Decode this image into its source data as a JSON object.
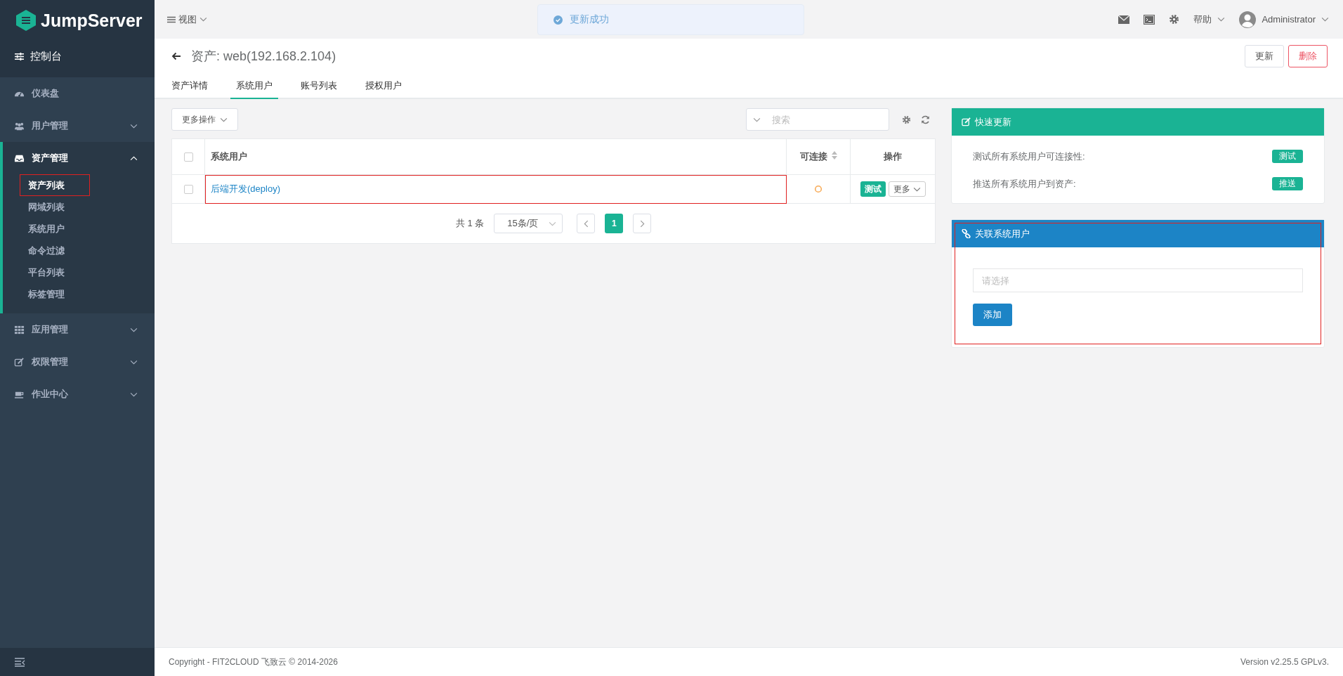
{
  "sidebar": {
    "logo": "JumpServer",
    "console": "控制台",
    "items": [
      {
        "label": "仪表盘",
        "kind": "link"
      },
      {
        "label": "用户管理",
        "kind": "group",
        "expanded": false
      },
      {
        "label": "资产管理",
        "kind": "group",
        "expanded": true,
        "children": [
          {
            "label": "资产列表",
            "selected": true,
            "highlighted": true
          },
          {
            "label": "网域列表",
            "selected": false,
            "highlighted": false
          },
          {
            "label": "系统用户",
            "selected": false,
            "highlighted": false
          },
          {
            "label": "命令过滤",
            "selected": false,
            "highlighted": false
          },
          {
            "label": "平台列表",
            "selected": false,
            "highlighted": false
          },
          {
            "label": "标签管理",
            "selected": false,
            "highlighted": false
          }
        ]
      },
      {
        "label": "应用管理",
        "kind": "group",
        "expanded": false
      },
      {
        "label": "权限管理",
        "kind": "group",
        "expanded": false
      },
      {
        "label": "作业中心",
        "kind": "group",
        "expanded": false
      }
    ]
  },
  "topbar": {
    "view_menu": "视图",
    "toast": "更新成功",
    "help": "帮助",
    "user": "Administrator"
  },
  "header": {
    "title": "资产: web(192.168.2.104)",
    "buttons": [
      {
        "label": "更新",
        "kind": "default"
      },
      {
        "label": "删除",
        "kind": "danger"
      }
    ],
    "tabs": [
      {
        "label": "资产详情",
        "selected": false
      },
      {
        "label": "系统用户",
        "selected": true
      },
      {
        "label": "账号列表",
        "selected": false
      },
      {
        "label": "授权用户",
        "selected": false
      }
    ]
  },
  "table": {
    "more_actions": "更多操作",
    "search": {
      "placeholder": "搜索"
    },
    "header_checked": false,
    "columns": [
      "系统用户",
      "可连接",
      "操作"
    ],
    "rows": [
      {
        "name": "后端开发(deploy)",
        "checked": false,
        "highlighted": true,
        "connectivity": {
          "color": "#f8ac59"
        },
        "test": "测试",
        "more": "更多"
      }
    ],
    "pagination": {
      "total": "共 1 条",
      "page_size": "15条/页",
      "pages": [
        {
          "label": "1",
          "selected": true
        }
      ]
    }
  },
  "panels": {
    "quick_update": {
      "title": "快速更新",
      "actions": [
        {
          "label": "测试所有系统用户可连接性:",
          "button": "测试"
        },
        {
          "label": "推送所有系统用户到资产:",
          "button": "推送"
        }
      ]
    },
    "relate": {
      "title": "关联系统用户",
      "placeholder": "请选择",
      "button": "添加",
      "highlighted": true
    }
  },
  "footer": {
    "copyright": "Copyright - FIT2CLOUD 飞致云 © 2014-2026",
    "version": "Version v2.25.5 GPLv3."
  }
}
